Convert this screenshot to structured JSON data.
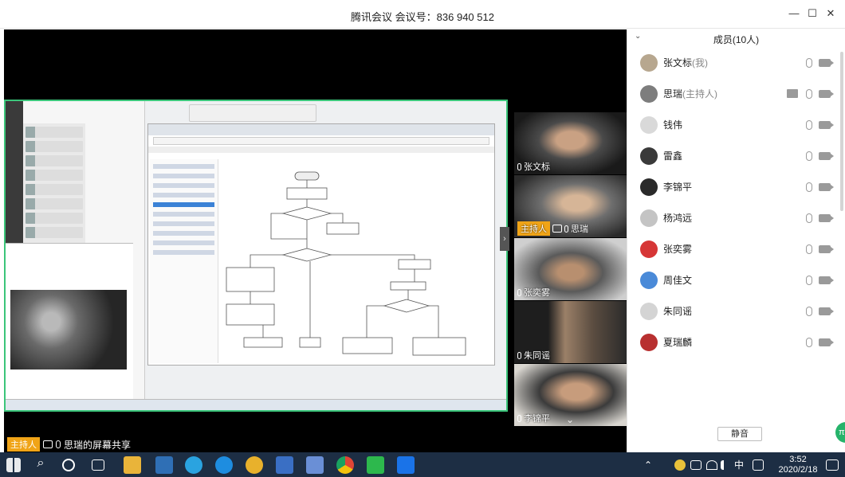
{
  "window": {
    "title": "腾讯会议 会议号：836 940 512",
    "minimize": "—",
    "maximize": "☐",
    "close": "✕"
  },
  "share": {
    "host_badge": "主持人",
    "caption": "思瑞的屏幕共享"
  },
  "tiles": [
    {
      "name": "张文标",
      "host": false
    },
    {
      "name": "思瑞",
      "host": true,
      "host_badge": "主持人"
    },
    {
      "name": "张奕雾",
      "host": false
    },
    {
      "name": "朱同谣",
      "host": false
    },
    {
      "name": "李锦平",
      "host": false
    }
  ],
  "panel": {
    "title": "成员(10人)",
    "members": [
      {
        "name": "张文标",
        "role": "(我)",
        "avatar_color": "#b7a78f",
        "share": false
      },
      {
        "name": "思瑞",
        "role": "(主持人)",
        "avatar_color": "#7d7d7d",
        "share": true
      },
      {
        "name": "钱伟",
        "role": "",
        "avatar_color": "#d9d9d9",
        "share": false
      },
      {
        "name": "雷鑫",
        "role": "",
        "avatar_color": "#3a3a3a",
        "share": false
      },
      {
        "name": "李锦平",
        "role": "",
        "avatar_color": "#2a2a2a",
        "share": false
      },
      {
        "name": "杨鸿远",
        "role": "",
        "avatar_color": "#c4c4c4",
        "share": false
      },
      {
        "name": "张奕雾",
        "role": "",
        "avatar_color": "#d63636",
        "share": false
      },
      {
        "name": "周佳文",
        "role": "",
        "avatar_color": "#4a8ad8",
        "share": false
      },
      {
        "name": "朱同谣",
        "role": "",
        "avatar_color": "#d4d4d4",
        "share": false
      },
      {
        "name": "夏瑞麟",
        "role": "",
        "avatar_color": "#b83030",
        "share": false
      }
    ],
    "mute_all": "静音"
  },
  "taskbar": {
    "ime": "中",
    "time": "3:52",
    "date": "2020/2/18"
  }
}
